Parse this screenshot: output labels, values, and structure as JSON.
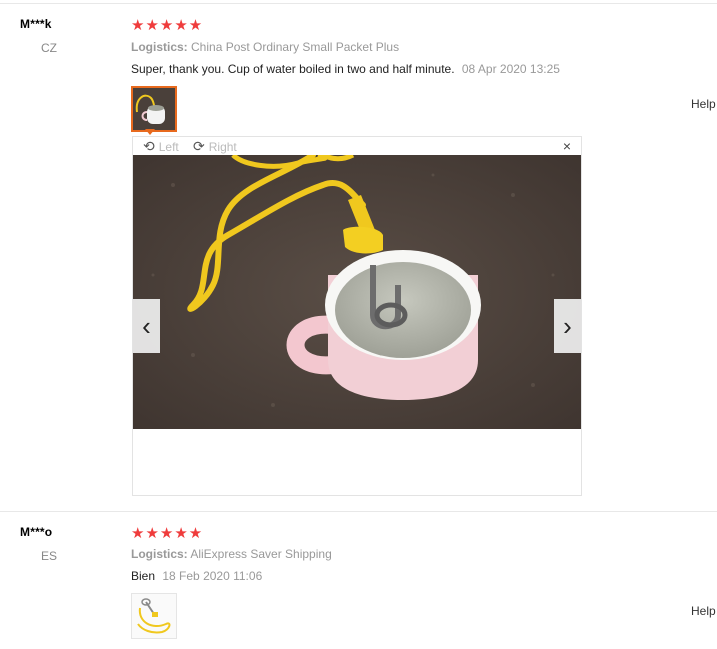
{
  "reviews": [
    {
      "user": "M***k",
      "country": "CZ",
      "stars": "★★★★★",
      "logistics_label": "Logistics:",
      "logistics_value": "China Post Ordinary Small Packet Plus",
      "comment": "Super, thank you. Cup of water boiled in two and half minute.",
      "date": "08 Apr 2020 13:25",
      "help": "Help",
      "rating": 5
    },
    {
      "user": "M***o",
      "country": "ES",
      "stars": "★★★★★",
      "logistics_label": "Logistics:",
      "logistics_value": "AliExpress Saver Shipping",
      "comment": "Bien",
      "date": "18 Feb 2020 11:06",
      "help": "Help",
      "rating": 5
    }
  ],
  "viewer": {
    "rotate_left": "Left",
    "rotate_right": "Right",
    "close": "×",
    "prev": "‹",
    "next": "›"
  },
  "icons": {
    "rotate_left": "rotate-left-icon",
    "rotate_right": "rotate-right-icon",
    "close": "close-icon",
    "star": "star-icon"
  },
  "colors": {
    "star": "#ef3c3c",
    "active_thumb": "#e86a1e",
    "cable": "#f0c81e"
  }
}
